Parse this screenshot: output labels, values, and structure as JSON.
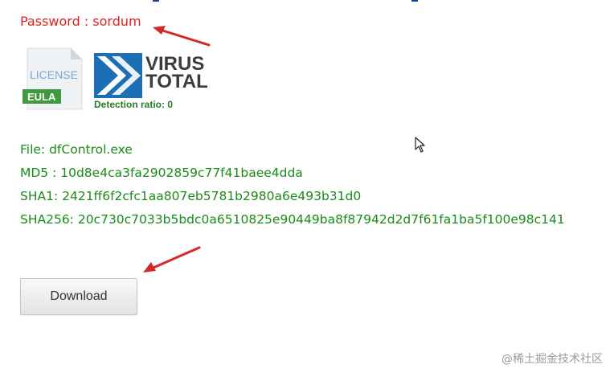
{
  "password_line": "Password : sordum",
  "license_icon": {
    "label": "LICENSE",
    "badge": "EULA"
  },
  "virustotal": {
    "word1": "VIRUS",
    "word2": "TOTAL",
    "detection_text": "Detection ratio:  0"
  },
  "file_info": {
    "file": "File: dfControl.exe",
    "md5": "MD5 : 10d8e4ca3fa2902859c77f41baee4dda",
    "sha1": "SHA1: 2421ff6f2cfc1aa807eb5781b2980a6e493b31d0",
    "sha256": "SHA256: 20c730c7033b5bdc0a6510825e90449ba8f87942d2d7f61fa1ba5f100e98c141"
  },
  "download_button": {
    "label": "Download"
  },
  "watermark": "@稀土掘金技术社区",
  "icons": {
    "arrow": "red-arrow-icon",
    "cursor": "mouse-pointer-icon",
    "license": "license-document-icon",
    "virustotal": "virustotal-logo"
  },
  "colors": {
    "password": "#e02020",
    "file_info": "#1a8a1a",
    "arrow": "#d62828",
    "vt_blue": "#1c6fb5",
    "eula_green": "#3f9a3f"
  }
}
